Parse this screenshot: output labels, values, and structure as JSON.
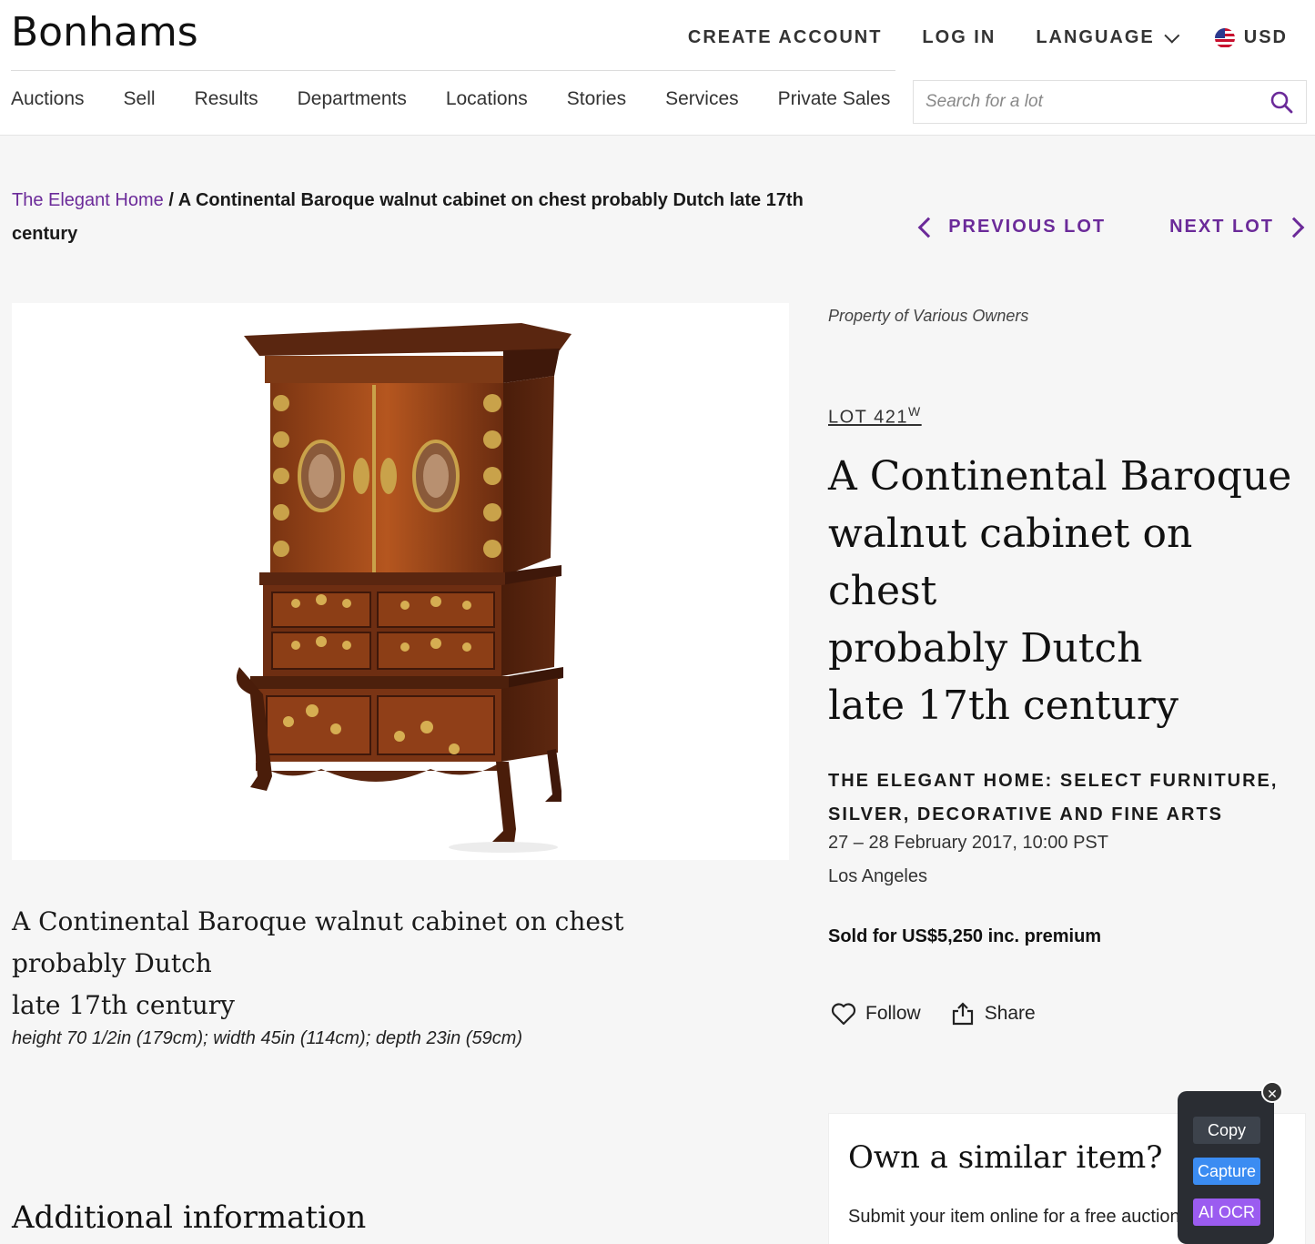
{
  "header": {
    "logo": "Bonhams",
    "top_links": {
      "create_account": "CREATE ACCOUNT",
      "log_in": "LOG IN",
      "language": "LANGUAGE",
      "currency": "USD"
    },
    "nav": [
      "Auctions",
      "Sell",
      "Results",
      "Departments",
      "Locations",
      "Stories",
      "Services",
      "Private Sales"
    ],
    "search_placeholder": "Search for a lot"
  },
  "breadcrumb": {
    "link": "The Elegant Home",
    "separator": " / ",
    "current": "A Continental Baroque walnut cabinet on chest probably Dutch late 17th century"
  },
  "lot_nav": {
    "previous": "PREVIOUS LOT",
    "next": "NEXT LOT"
  },
  "lot": {
    "owners": "Property of Various Owners",
    "number": "LOT 421",
    "number_sup": "W",
    "title_lines": [
      "A Continental Baroque",
      "walnut cabinet on",
      "chest",
      "probably Dutch",
      "late 17th century"
    ],
    "caption_lines": [
      "A Continental Baroque walnut cabinet on chest",
      "probably Dutch",
      "late 17th century"
    ],
    "dimensions": "height 70 1/2in (179cm); width 45in (114cm); depth 23in (59cm)",
    "sale_name": "THE ELEGANT HOME: SELECT FURNITURE, SILVER, DECORATIVE AND FINE ARTS",
    "sale_date": "27 – 28 February 2017, 10:00 PST",
    "sale_location": "Los Angeles",
    "sold": "Sold for US$5,250 inc. premium",
    "follow": "Follow",
    "share": "Share",
    "image_alt": "cabinet-on-chest-photo"
  },
  "additional": {
    "heading": "Additional information"
  },
  "similar": {
    "heading": "Own a similar item?",
    "text": "Submit your item online for a free auction estimate."
  },
  "ocr_popup": {
    "close": "✕",
    "copy": "Copy",
    "capture": "Capture",
    "ai_ocr": "AI OCR"
  },
  "colors": {
    "accent": "#6b2a99",
    "background": "#f6f6f6"
  }
}
